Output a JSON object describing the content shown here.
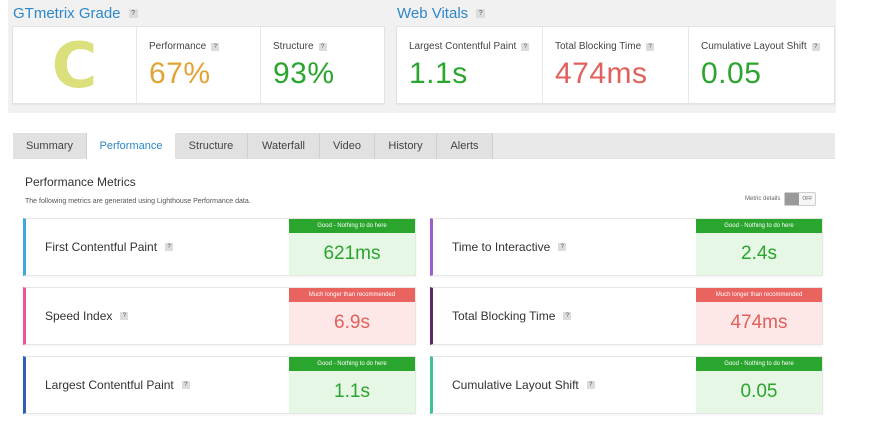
{
  "grade": {
    "title": "GTmetrix Grade",
    "letter": "C",
    "performance_label": "Performance",
    "performance_value": "67%",
    "structure_label": "Structure",
    "structure_value": "93%"
  },
  "web_vitals": {
    "title": "Web Vitals",
    "lcp_label": "Largest Contentful Paint",
    "lcp_value": "1.1s",
    "tbt_label": "Total Blocking Time",
    "tbt_value": "474ms",
    "cls_label": "Cumulative Layout Shift",
    "cls_value": "0.05"
  },
  "help_glyph": "?",
  "tabs": [
    "Summary",
    "Performance",
    "Structure",
    "Waterfall",
    "Video",
    "History",
    "Alerts"
  ],
  "active_tab": "Performance",
  "performance_section": {
    "title": "Performance Metrics",
    "subtitle": "The following metrics are generated using Lighthouse Performance data.",
    "toggle_label": "Metric details",
    "toggle_state": "OFF"
  },
  "metrics": [
    {
      "name": "First Contentful Paint",
      "status": "Good - Nothing to do here",
      "value": "621ms",
      "rating": "good",
      "accent": "#40a9dc"
    },
    {
      "name": "Time to Interactive",
      "status": "Good - Nothing to do here",
      "value": "2.4s",
      "rating": "good",
      "accent": "#9b5fc6"
    },
    {
      "name": "Speed Index",
      "status": "Much longer than recommended",
      "value": "6.9s",
      "rating": "bad",
      "accent": "#e8579c"
    },
    {
      "name": "Total Blocking Time",
      "status": "Much longer than recommended",
      "value": "474ms",
      "rating": "bad",
      "accent": "#5c2a6b"
    },
    {
      "name": "Largest Contentful Paint",
      "status": "Good - Nothing to do here",
      "value": "1.1s",
      "rating": "good",
      "accent": "#2d5fb8"
    },
    {
      "name": "Cumulative Layout Shift",
      "status": "Good - Nothing to do here",
      "value": "0.05",
      "rating": "good",
      "accent": "#3ec09b"
    }
  ],
  "colors": {
    "performance": "#e0a435",
    "structure": "#2aa52d",
    "good": "#2aa52d",
    "bad": "#e0605c",
    "link": "#2d87c9"
  }
}
